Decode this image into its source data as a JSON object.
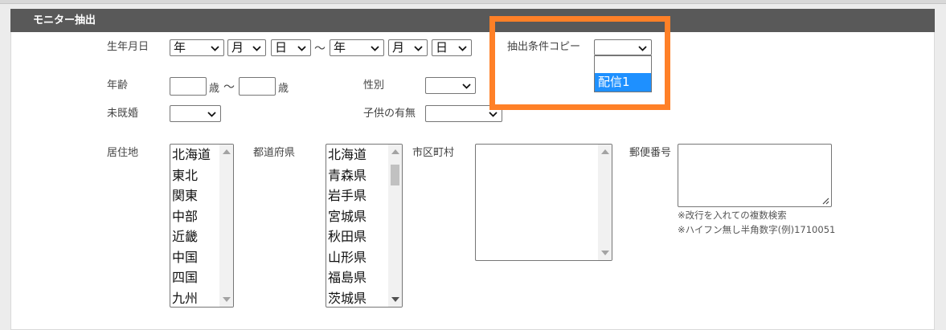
{
  "panel": {
    "title": "モニター抽出"
  },
  "birthdate": {
    "label": "生年月日",
    "from": {
      "year": "年",
      "month": "月",
      "day": "日"
    },
    "separator": "～",
    "to": {
      "year": "年",
      "month": "月",
      "day": "日"
    }
  },
  "copy_condition": {
    "label": "抽出条件コピー",
    "options": [
      "",
      "配信1"
    ],
    "highlighted_option": "配信1"
  },
  "age": {
    "label": "年齢",
    "unit": "歳",
    "separator": "～"
  },
  "gender": {
    "label": "性別"
  },
  "marital": {
    "label": "未既婚"
  },
  "children": {
    "label": "子供の有無"
  },
  "residence": {
    "label": "居住地",
    "options": [
      "北海道",
      "東北",
      "関東",
      "中部",
      "近畿",
      "中国",
      "四国",
      "九州"
    ]
  },
  "prefecture": {
    "label": "都道府県",
    "options": [
      "北海道",
      "青森県",
      "岩手県",
      "宮城県",
      "秋田県",
      "山形県",
      "福島県",
      "茨城県"
    ]
  },
  "city": {
    "label": "市区町村"
  },
  "postal": {
    "label": "郵便番号",
    "note1": "※改行を入れての複数検索",
    "note2": "※ハイフン無し半角数字(例)1710051"
  },
  "colors": {
    "header_bg": "#595959",
    "highlight": "#ff8027",
    "selected": "#1e90ff"
  }
}
